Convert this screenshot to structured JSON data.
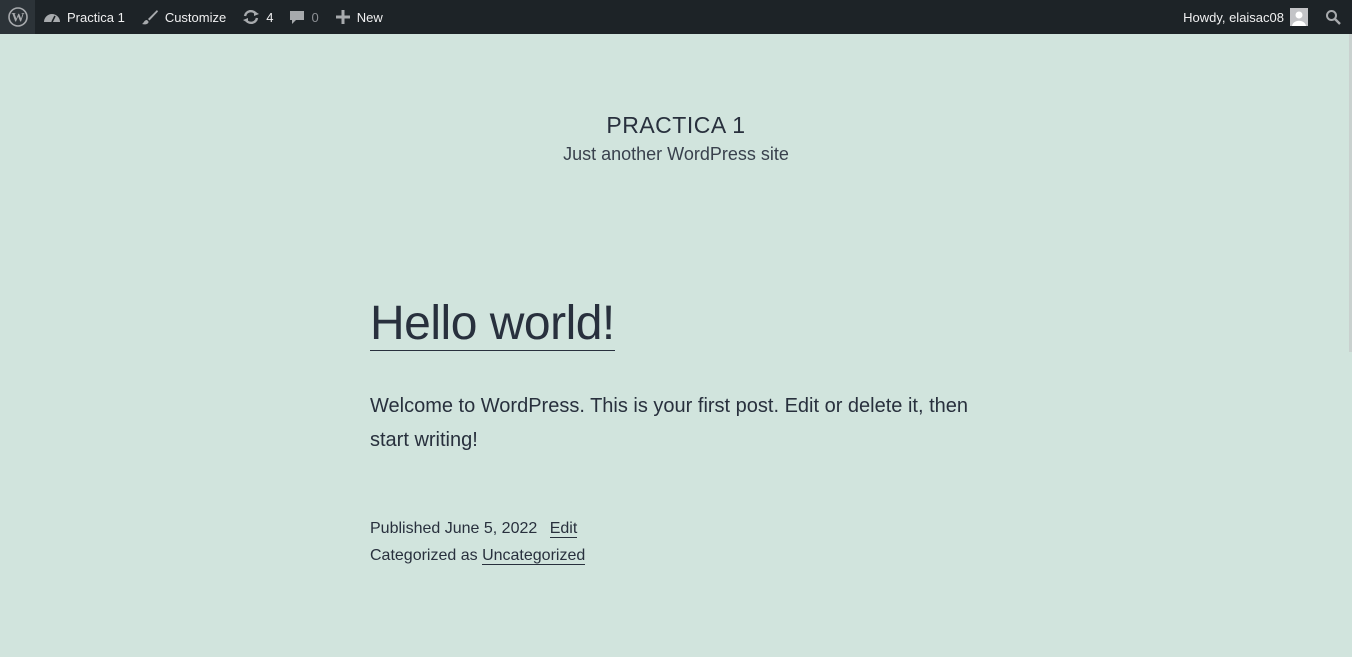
{
  "adminbar": {
    "site_name": "Practica 1",
    "customize_label": "Customize",
    "updates_count": "4",
    "comments_count": "0",
    "new_label": "New",
    "howdy_label": "Howdy, elaisac08"
  },
  "site": {
    "title": "PRACTICA 1",
    "description": "Just another WordPress site"
  },
  "post": {
    "title": "Hello world!",
    "content": "Welcome to WordPress. This is your first post. Edit or delete it, then start writing!",
    "published_label": "Published",
    "date": "June 5, 2022",
    "edit_label": "Edit",
    "categorized_label": "Categorized as",
    "category": "Uncategorized"
  },
  "colors": {
    "background": "#d1e4dd",
    "adminbar": "#1d2327",
    "text": "#28303d"
  }
}
